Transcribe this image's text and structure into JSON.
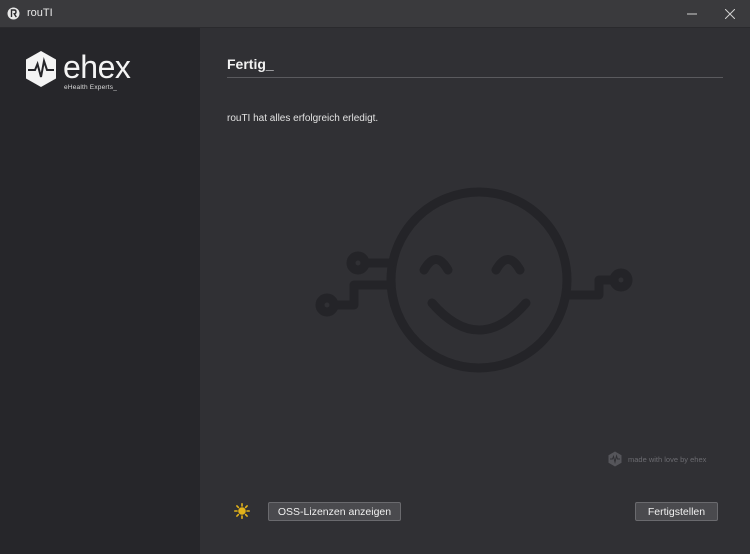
{
  "window": {
    "title": "rouTI"
  },
  "brand": {
    "name": "ehex",
    "tagline": "eHealth Experts_"
  },
  "page": {
    "heading": "Fertig_",
    "message": "rouTI hat alles erfolgreich erledigt."
  },
  "credit": {
    "text": "made with love by ehex"
  },
  "buttons": {
    "oss_label": "OSS-Lizenzen anzeigen",
    "finish_label": "Fertigstellen"
  },
  "colors": {
    "sidebar": "#26262a",
    "main": "#303034",
    "titlebar": "#3a3a3d",
    "accent_sun": "#e2b21a",
    "smiley": "#242428"
  },
  "icons": [
    "app-icon",
    "minimize-icon",
    "close-icon",
    "ehex-logo-icon",
    "smiley-robot-icon",
    "ehex-small-logo-icon",
    "sun-icon"
  ]
}
